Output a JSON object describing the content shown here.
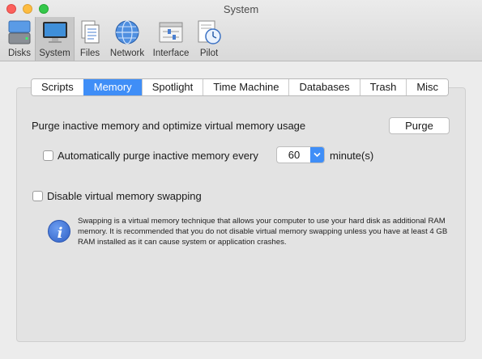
{
  "window": {
    "title": "System"
  },
  "toolbar": {
    "items": [
      {
        "label": "Disks",
        "icon": "disks-icon"
      },
      {
        "label": "System",
        "icon": "monitor-icon",
        "selected": true
      },
      {
        "label": "Files",
        "icon": "files-icon"
      },
      {
        "label": "Network",
        "icon": "globe-icon"
      },
      {
        "label": "Interface",
        "icon": "interface-icon"
      },
      {
        "label": "Pilot",
        "icon": "pilot-icon"
      }
    ]
  },
  "tabs": [
    "Scripts",
    "Memory",
    "Spotlight",
    "Time Machine",
    "Databases",
    "Trash",
    "Misc"
  ],
  "active_tab": "Memory",
  "memory": {
    "purge_label": "Purge inactive memory and optimize virtual memory usage",
    "purge_button": "Purge",
    "auto_purge_label": "Automatically purge inactive memory every",
    "auto_purge_checked": false,
    "auto_purge_value": "60",
    "auto_purge_unit": "minute(s)",
    "disable_swap_label": "Disable virtual memory swapping",
    "disable_swap_checked": false,
    "info_text": "Swapping is a virtual memory technique that allows your computer to use your hard disk as additional RAM memory. It is recommended that you do not disable virtual memory swapping unless you have at least 4 GB RAM installed as it can cause system or application crashes."
  },
  "colors": {
    "accent": "#3f8ef7",
    "info_icon": "#3a6fd8"
  }
}
